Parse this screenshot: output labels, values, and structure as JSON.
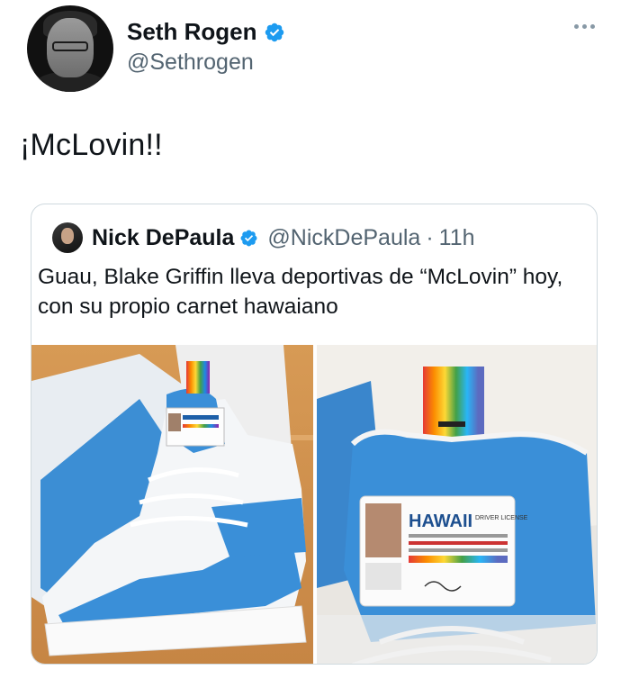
{
  "tweet": {
    "author_name": "Seth Rogen",
    "author_handle": "@Sethrogen",
    "text": "¡McLovin!!",
    "verified": true
  },
  "quoted_tweet": {
    "author_name": "Nick DePaula",
    "author_handle": "@NickDePaula",
    "separator": "·",
    "time": "11h",
    "verified": true,
    "text": "Guau, Blake Griffin lleva deportivas de “McLovin” hoy, con su propio carnet hawaiano"
  },
  "media": {
    "license_state": "HAWAII",
    "license_type": "DRIVER LICENSE"
  },
  "icons": {
    "verified": "verified-badge-icon",
    "more": "more-options-icon"
  },
  "colors": {
    "verified_blue": "#1d9bf0",
    "text": "#0f1419",
    "secondary_text": "#536471",
    "shoe_blue": "#3a8fd8"
  }
}
